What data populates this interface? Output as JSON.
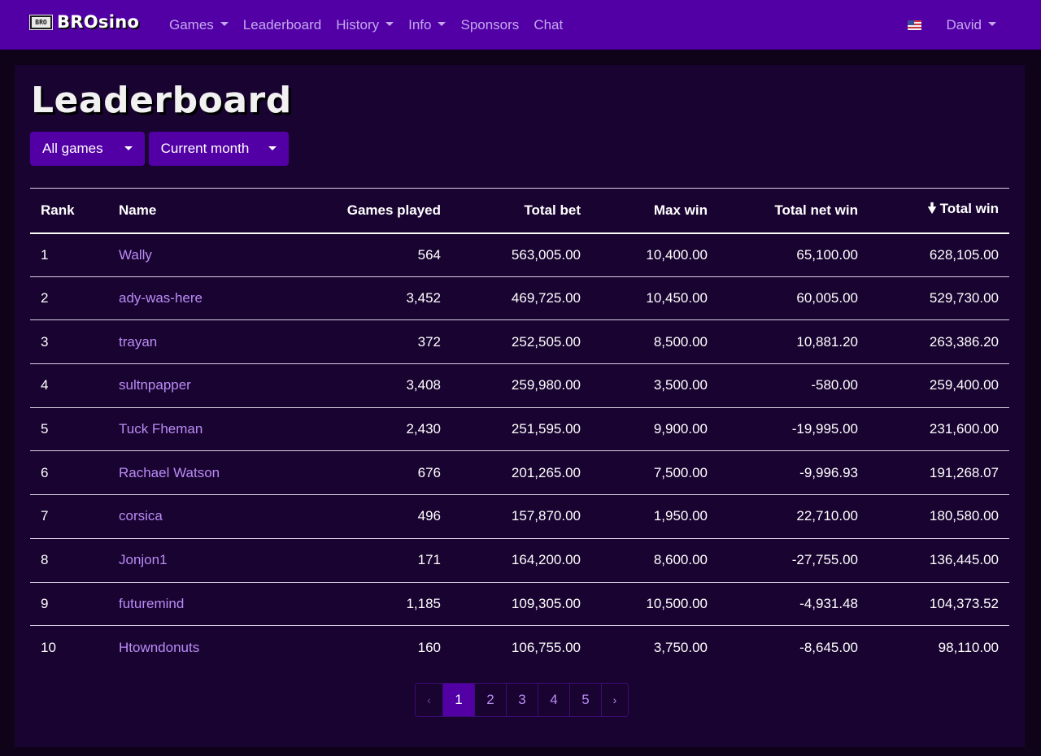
{
  "brand": {
    "logo_text": "BRO",
    "name": "BROsino"
  },
  "nav": {
    "items": [
      {
        "label": "Games",
        "dropdown": true
      },
      {
        "label": "Leaderboard",
        "dropdown": false
      },
      {
        "label": "History",
        "dropdown": true
      },
      {
        "label": "Info",
        "dropdown": true
      },
      {
        "label": "Sponsors",
        "dropdown": false
      },
      {
        "label": "Chat",
        "dropdown": false
      }
    ],
    "language_flag": "us-flag-icon",
    "user": "David"
  },
  "page": {
    "title": "Leaderboard"
  },
  "filters": {
    "game": "All games",
    "period": "Current month"
  },
  "table": {
    "columns": [
      "Rank",
      "Name",
      "Games played",
      "Total bet",
      "Max win",
      "Total net win",
      "Total win"
    ],
    "sort_column": "Total win",
    "sort_direction": "descending",
    "rows": [
      [
        "1",
        "Wally",
        "564",
        "563,005.00",
        "10,400.00",
        "65,100.00",
        "628,105.00"
      ],
      [
        "2",
        "ady-was-here",
        "3,452",
        "469,725.00",
        "10,450.00",
        "60,005.00",
        "529,730.00"
      ],
      [
        "3",
        "trayan",
        "372",
        "252,505.00",
        "8,500.00",
        "10,881.20",
        "263,386.20"
      ],
      [
        "4",
        "sultnpapper",
        "3,408",
        "259,980.00",
        "3,500.00",
        "-580.00",
        "259,400.00"
      ],
      [
        "5",
        "Tuck Fheman",
        "2,430",
        "251,595.00",
        "9,900.00",
        "-19,995.00",
        "231,600.00"
      ],
      [
        "6",
        "Rachael Watson",
        "676",
        "201,265.00",
        "7,500.00",
        "-9,996.93",
        "191,268.07"
      ],
      [
        "7",
        "corsica",
        "496",
        "157,870.00",
        "1,950.00",
        "22,710.00",
        "180,580.00"
      ],
      [
        "8",
        "Jonjon1",
        "171",
        "164,200.00",
        "8,600.00",
        "-27,755.00",
        "136,445.00"
      ],
      [
        "9",
        "futuremind",
        "1,185",
        "109,305.00",
        "10,500.00",
        "-4,931.48",
        "104,373.52"
      ],
      [
        "10",
        "Htowndonuts",
        "160",
        "106,755.00",
        "3,750.00",
        "-8,645.00",
        "98,110.00"
      ]
    ]
  },
  "pagination": {
    "prev": "‹",
    "next": "›",
    "pages": [
      "1",
      "2",
      "3",
      "4",
      "5"
    ],
    "current": "1"
  },
  "colors": {
    "navbar": "#5200a6",
    "background": "#0e0318",
    "panel": "#190330",
    "link": "#b98cf5",
    "nav_link": "#c3a9ec"
  }
}
